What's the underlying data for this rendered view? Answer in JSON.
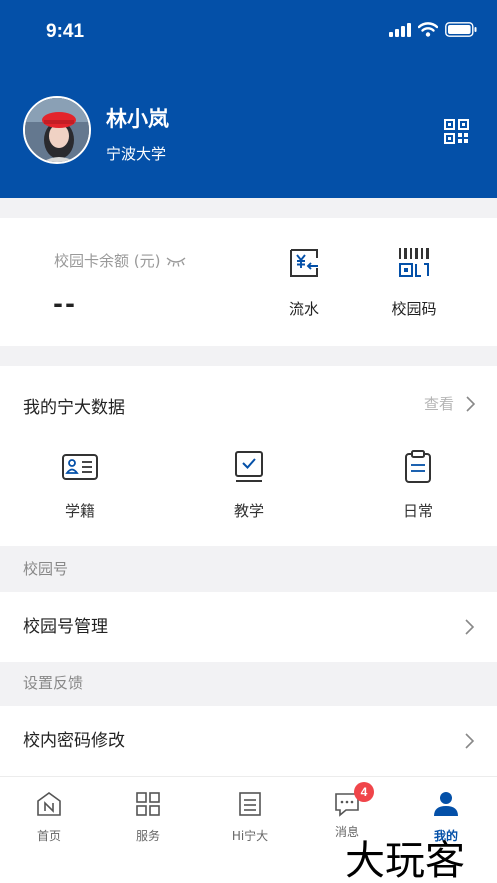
{
  "status_bar": {
    "time": "9:41"
  },
  "profile": {
    "name": "林小岚",
    "school": "宁波大学"
  },
  "campus_card": {
    "balance_label": "校园卡余额 (元)",
    "balance_value": "--",
    "actions": [
      {
        "label": "流水",
        "icon": "transaction-history-icon"
      },
      {
        "label": "校园码",
        "icon": "campus-barcode-icon"
      }
    ]
  },
  "my_data": {
    "title": "我的宁大数据",
    "more_label": "查看",
    "items": [
      {
        "label": "学籍",
        "icon": "student-id-icon"
      },
      {
        "label": "教学",
        "icon": "teaching-icon"
      },
      {
        "label": "日常",
        "icon": "daily-clipboard-icon"
      }
    ]
  },
  "groups": [
    {
      "header": "校园号",
      "rows": [
        "校园号管理"
      ]
    },
    {
      "header": "设置反馈",
      "rows": [
        "校内密码修改"
      ]
    }
  ],
  "tabs": [
    {
      "label": "首页",
      "icon": "home-icon"
    },
    {
      "label": "服务",
      "icon": "services-grid-icon"
    },
    {
      "label": "Hi宁大",
      "icon": "document-list-icon"
    },
    {
      "label": "消息",
      "icon": "message-icon",
      "badge": "4"
    },
    {
      "label": "我的",
      "icon": "profile-icon",
      "active": true
    }
  ],
  "watermark": "大玩客",
  "colors": {
    "primary": "#0450a8",
    "badge": "#f0454a",
    "background": "#f2f2f4"
  }
}
